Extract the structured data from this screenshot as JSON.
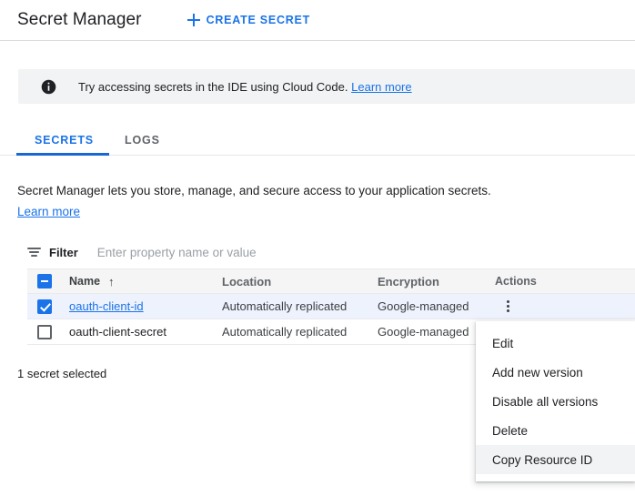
{
  "header": {
    "title": "Secret Manager",
    "create_button_label": "CREATE SECRET",
    "plus_icon": "plus-icon"
  },
  "banner": {
    "icon": "info-icon",
    "text": "Try accessing secrets in the IDE using Cloud Code.",
    "link_label": "Learn more"
  },
  "tabs": [
    {
      "label": "SECRETS",
      "active": true
    },
    {
      "label": "LOGS",
      "active": false
    }
  ],
  "description": {
    "text": "Secret Manager lets you store, manage, and secure access to your application secrets.",
    "link_label": "Learn more"
  },
  "filter": {
    "icon": "filter-icon",
    "label": "Filter",
    "placeholder": "Enter property name or value",
    "value": ""
  },
  "table": {
    "columns": [
      "Name",
      "Location",
      "Encryption",
      "Actions"
    ],
    "sort_column": "Name",
    "sort_direction": "ascending",
    "sort_icon": "↑",
    "header_checkbox_state": "indeterminate",
    "rows": [
      {
        "checked": true,
        "selected": true,
        "name": "oauth-client-id",
        "is_link": true,
        "location": "Automatically replicated",
        "encryption": "Google-managed",
        "actions_icon": "more-vert-icon"
      },
      {
        "checked": false,
        "selected": false,
        "name": "oauth-client-secret",
        "is_link": false,
        "location": "Automatically replicated",
        "encryption": "Google-managed",
        "actions_icon": "more-vert-icon"
      }
    ]
  },
  "selection_status": "1 secret selected",
  "context_menu": {
    "items": [
      {
        "label": "Edit",
        "hovered": false
      },
      {
        "label": "Add new version",
        "hovered": false
      },
      {
        "label": "Disable all versions",
        "hovered": false
      },
      {
        "label": "Delete",
        "hovered": false
      },
      {
        "label": "Copy Resource ID",
        "hovered": true
      }
    ]
  },
  "colors": {
    "accent": "#1a73e8",
    "selected_row": "#eef2fd",
    "header_row": "#f5f5f5",
    "banner_bg": "#f1f3f4",
    "menu_hover": "#f1f3f4"
  }
}
